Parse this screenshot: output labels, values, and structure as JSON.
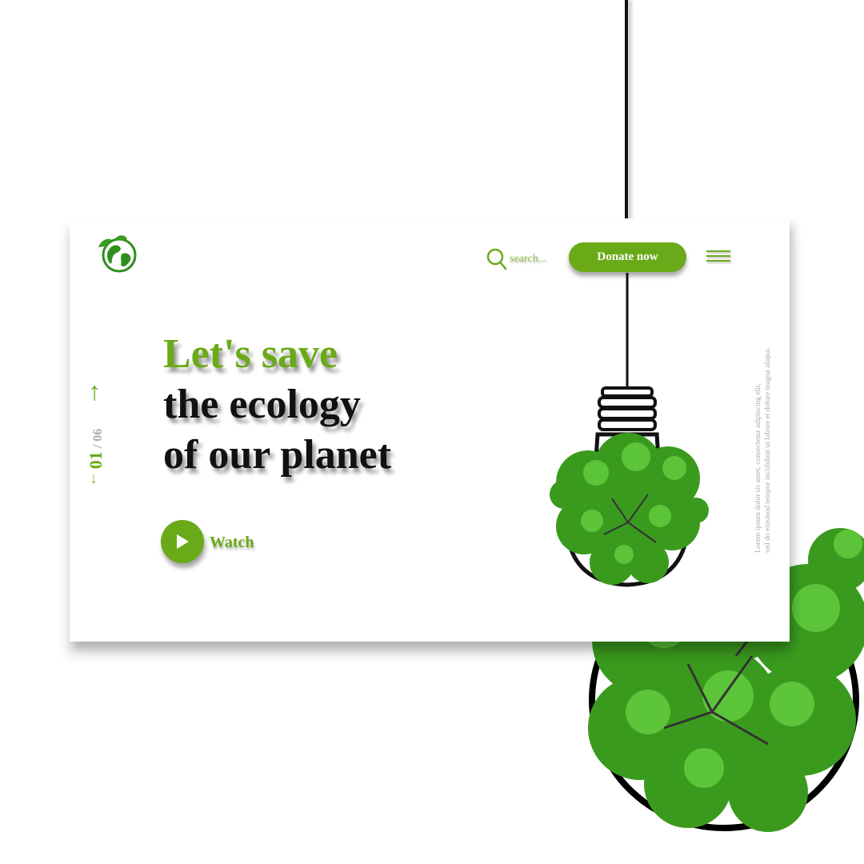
{
  "brand": {
    "logo_icon": "earth-leaf-icon"
  },
  "search": {
    "placeholder": "search..."
  },
  "actions": {
    "donate_label": "Donate now"
  },
  "slider": {
    "current": "01",
    "separator": "/",
    "total": "06"
  },
  "hero": {
    "line1": "Let's save",
    "line2": "the ecology",
    "line3": "of our planet",
    "watch_label": "Watch"
  },
  "side_text": {
    "line1": "Lorem ipsum dolor sit amet, consectetur adipiscing elit,",
    "line2": "sed do eiusmod tempor incididunt ut labore et dolore magna aliqua."
  },
  "colors": {
    "accent": "#6aaa19",
    "accent_light": "#8dbf4a",
    "text": "#111111",
    "muted": "#aaaaaa"
  }
}
